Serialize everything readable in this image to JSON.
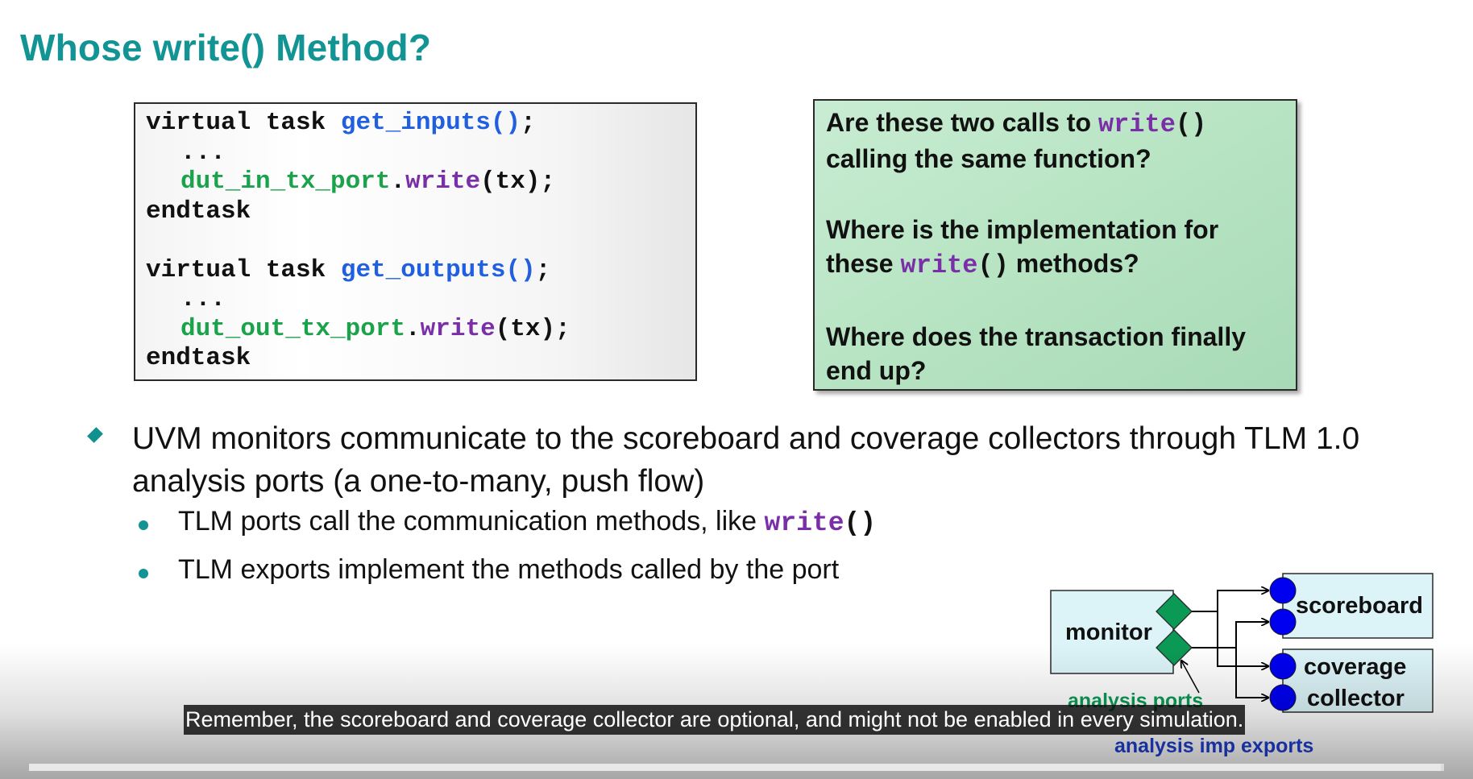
{
  "slide": {
    "title": "Whose write() Method?",
    "code": {
      "l1_kw": "virtual task ",
      "l1_fn": "get_inputs()",
      "l1_end": ";",
      "l2": "...",
      "l3_port": "dut_in_tx_port",
      "l3_dot": ".",
      "l3_method": "write",
      "l3_args": "(tx);",
      "l4": "endtask",
      "l5_kw": "virtual task ",
      "l5_fn": "get_outputs()",
      "l5_end": ";",
      "l6": "...",
      "l7_port": "dut_out_tx_port",
      "l7_dot": ".",
      "l7_method": "write",
      "l7_args": "(tx);",
      "l8": "endtask"
    },
    "questions": {
      "q1_pre": "Are these two calls to ",
      "q1_method": "write",
      "q1_paren": "()",
      "q1_post": " calling the same function?",
      "q2_pre": "Where is the implementation for these ",
      "q2_method": "write",
      "q2_paren": "()",
      "q2_post": " methods?",
      "q3": "Where does the transaction finally end up?"
    },
    "bullet_main": "UVM monitors communicate to the scoreboard and coverage collectors through TLM 1.0 analysis ports (a one-to-many, push flow)",
    "sub1_pre": "TLM ports call the communication methods, like ",
    "sub1_method": "write",
    "sub1_paren": "()",
    "sub2": "TLM exports implement the methods called by the port",
    "diagram": {
      "monitor": "monitor",
      "scoreboard": "scoreboard",
      "coverage_l1": "coverage",
      "coverage_l2": "collector",
      "analysis_ports": "analysis ports",
      "analysis_imp_exports": "analysis imp exports"
    }
  },
  "player": {
    "caption": "Remember, the scoreboard and coverage collector are optional, and might not be enabled in every simulation.",
    "progress_fraction": 0.998
  }
}
